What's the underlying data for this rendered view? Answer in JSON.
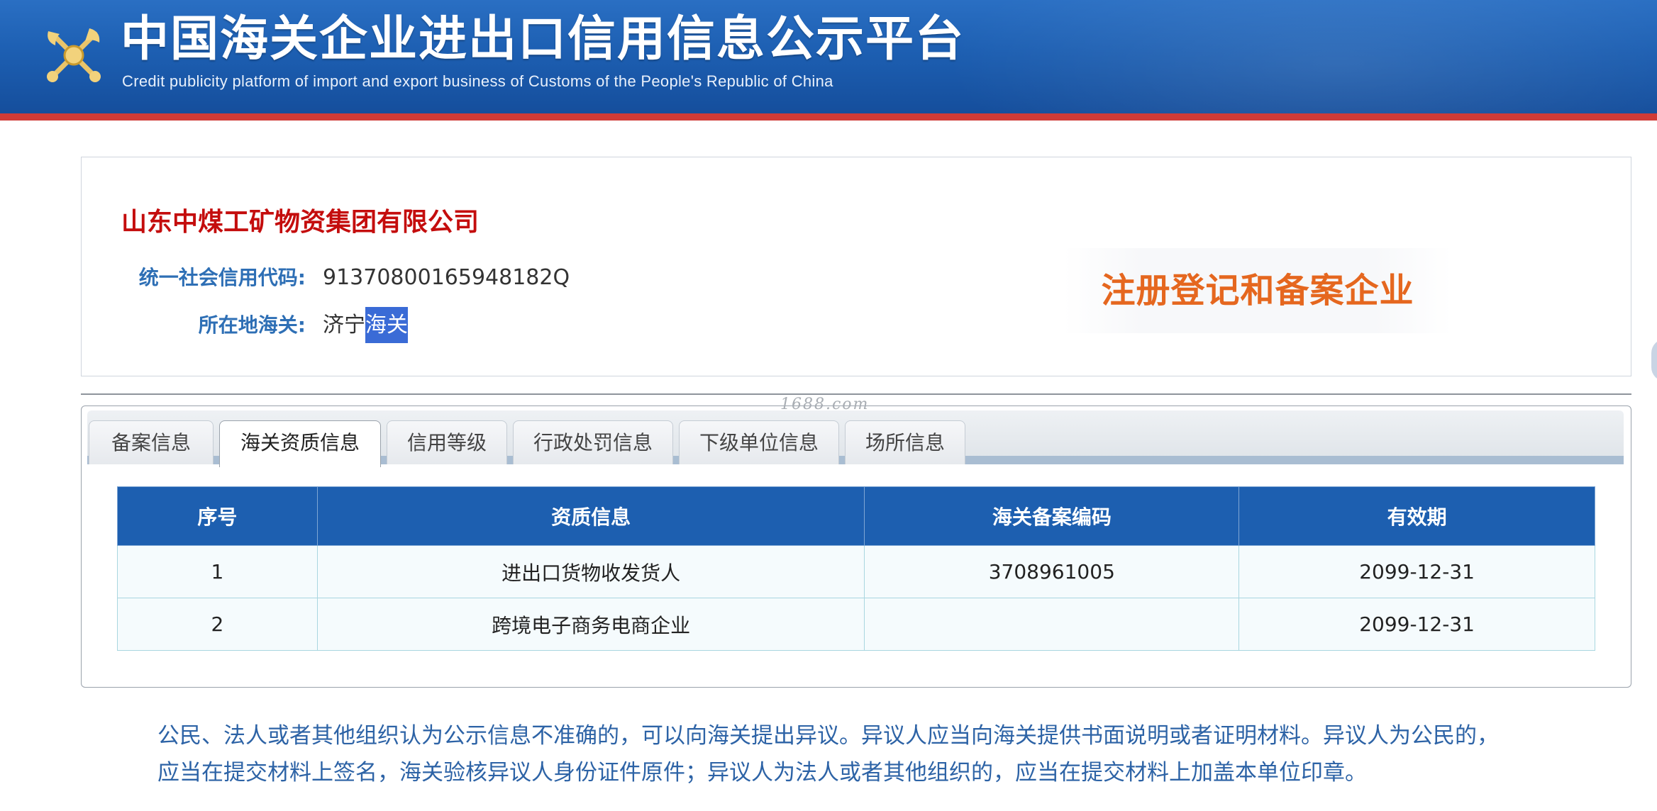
{
  "header": {
    "title": "中国海关企业进出口信用信息公示平台",
    "subtitle": "Credit publicity platform of import and export business of Customs of the People's Republic of China",
    "emblem_icon": "customs-emblem-icon",
    "colors": {
      "bar": "#1d5fb2",
      "stripe": "#cf3b37"
    }
  },
  "company": {
    "name": "山东中煤工矿物资集团有限公司",
    "credit_code_label": "统一社会信用代码:",
    "credit_code": "91370800165948182Q",
    "customs_label": "所在地海关:",
    "customs_prefix": "济宁",
    "customs_selected": "海关",
    "status": "注册登记和备案企业",
    "status_color": "#e5671f"
  },
  "watermark": "1688.com",
  "tabs": [
    {
      "label": "备案信息",
      "active": false
    },
    {
      "label": "海关资质信息",
      "active": true
    },
    {
      "label": "信用等级",
      "active": false
    },
    {
      "label": "行政处罚信息",
      "active": false
    },
    {
      "label": "下级单位信息",
      "active": false
    },
    {
      "label": "场所信息",
      "active": false
    }
  ],
  "table": {
    "headers": [
      "序号",
      "资质信息",
      "海关备案编码",
      "有效期"
    ],
    "rows": [
      [
        "1",
        "进出口货物收发货人",
        "3708961005",
        "2099-12-31"
      ],
      [
        "2",
        "跨境电子商务电商企业",
        "",
        "2099-12-31"
      ]
    ]
  },
  "notice": {
    "line1": "公民、法人或者其他组织认为公示信息不准确的，可以向海关提出异议。异议人应当向海关提供书面说明或者证明材料。异议人为公民的，",
    "line2": "应当在提交材料上签名，海关验核异议人身份证件原件；异议人为法人或者其他组织的，应当在提交材料上加盖本单位印章。"
  }
}
